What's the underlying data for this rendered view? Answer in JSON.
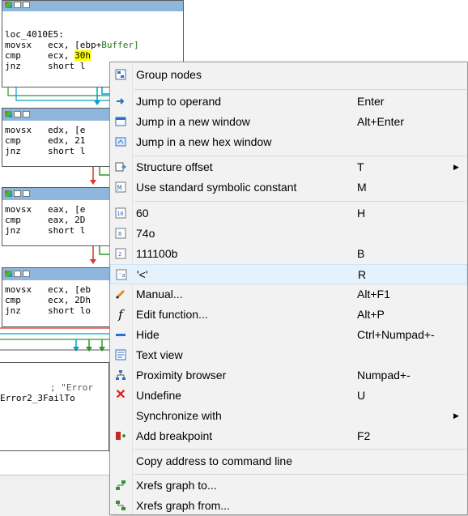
{
  "graph": {
    "node1": {
      "lines": [
        "loc_4010E5:",
        "movsx   ecx, [ebp+",
        "cmp     ecx, ",
        "jnz     short l"
      ],
      "buffer_text": "Buffer]",
      "imm": "30h"
    },
    "node2": {
      "lines": [
        "movsx   edx, [e",
        "cmp     edx, 21",
        "jnz     short l"
      ]
    },
    "node3": {
      "lines": [
        "movsx   eax, [e",
        "cmp     eax, 2D",
        "jnz     short l"
      ]
    },
    "node4": {
      "lines": [
        "movsx   ecx, [eb",
        "cmp     ecx, 2Dh",
        "jnz     short lo"
      ]
    },
    "tail": {
      "comment": "; \"Error",
      "label": "Error2_3FailTo"
    }
  },
  "menu": {
    "items": [
      {
        "label": "Group nodes",
        "shortcut": "",
        "icon": "group-nodes-icon"
      },
      {
        "label": "Jump to operand",
        "shortcut": "Enter",
        "icon": "jump-operand-icon"
      },
      {
        "label": "Jump in a new window",
        "shortcut": "Alt+Enter",
        "icon": "new-window-icon"
      },
      {
        "label": "Jump in a new hex window",
        "shortcut": "",
        "icon": "hex-window-icon"
      },
      {
        "label": "Structure offset",
        "shortcut": "T",
        "icon": "structure-offset-icon",
        "submenu": true
      },
      {
        "label": "Use standard symbolic constant",
        "shortcut": "M",
        "icon": "symbolic-constant-icon"
      },
      {
        "label": "60",
        "shortcut": "H",
        "icon": "decimal-icon"
      },
      {
        "label": "74o",
        "shortcut": "",
        "icon": "octal-icon"
      },
      {
        "label": "111100b",
        "shortcut": "B",
        "icon": "binary-icon"
      },
      {
        "label": "'<'",
        "shortcut": "R",
        "icon": "char-icon",
        "selected": true
      },
      {
        "label": "Manual...",
        "shortcut": "Alt+F1",
        "icon": "manual-icon"
      },
      {
        "label": "Edit function...",
        "shortcut": "Alt+P",
        "icon": "function-icon"
      },
      {
        "label": "Hide",
        "shortcut": "Ctrl+Numpad+-",
        "icon": "hide-icon"
      },
      {
        "label": "Text view",
        "shortcut": "",
        "icon": "text-view-icon"
      },
      {
        "label": "Proximity browser",
        "shortcut": "Numpad+-",
        "icon": "proximity-icon"
      },
      {
        "label": "Undefine",
        "shortcut": "U",
        "icon": "undefine-icon"
      },
      {
        "label": "Synchronize with",
        "shortcut": "",
        "icon": "",
        "submenu": true
      },
      {
        "label": "Add breakpoint",
        "shortcut": "F2",
        "icon": "breakpoint-icon"
      },
      {
        "label": "Copy address to command line",
        "shortcut": "",
        "icon": ""
      },
      {
        "label": "Xrefs graph to...",
        "shortcut": "",
        "icon": "xrefs-to-icon"
      },
      {
        "label": "Xrefs graph from...",
        "shortcut": "",
        "icon": "xrefs-from-icon"
      }
    ]
  },
  "colors": {
    "node_title": "#8fb7dd",
    "menu_bg": "#f2f2f2",
    "menu_selected": "#e5f1fb",
    "edge_blue": "#00a0d0",
    "edge_red": "#e03030",
    "edge_green": "#2a9a2a",
    "highlight": "#ffff00"
  }
}
